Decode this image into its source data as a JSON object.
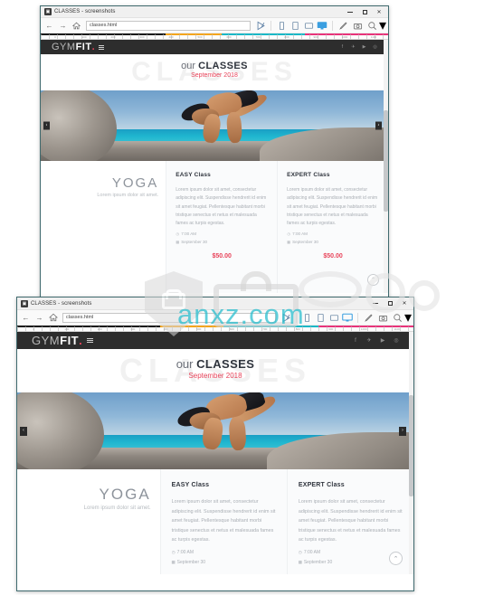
{
  "windows": {
    "top": {
      "title": "CLASSES - screenshots",
      "url": "classes.html"
    },
    "bottom": {
      "title": "CLASSES - screenshots",
      "url": "classes.html"
    }
  },
  "toolbar": {
    "back_icon": "←",
    "forward_icon": "→",
    "home_icon": "⌂",
    "play_icon": "▷",
    "phone_icon": "phone",
    "tablet_portrait_icon": "tablet-portrait",
    "tablet_landscape_icon": "tablet-landscape",
    "desktop_icon": "desktop",
    "pen_icon": "pen",
    "camera_icon": "camera",
    "inspect_icon": "inspect",
    "dropdown_caret": "▾"
  },
  "window_controls": {
    "minimize": "—",
    "maximize": "☐",
    "close": "✕"
  },
  "ruler": {
    "labels": [
      "0",
      "100",
      "200",
      "300",
      "400",
      "500",
      "600",
      "700",
      "800",
      "900",
      "1000",
      "1100"
    ],
    "segments": [
      {
        "color": "#1b1b1b",
        "left": "0%",
        "width": "36%"
      },
      {
        "color": "#f4a51c",
        "left": "36%",
        "width": "16%"
      },
      {
        "color": "#19b8c6",
        "left": "52%",
        "width": "24%"
      },
      {
        "color": "#e8337a",
        "left": "76%",
        "width": "24%"
      }
    ]
  },
  "site": {
    "logo": {
      "gym": "GYM",
      "fit": "FIT",
      "dot": "."
    },
    "menu_icon": "hamburger-icon",
    "socials": [
      {
        "name": "facebook-icon",
        "glyph": "f"
      },
      {
        "name": "twitter-icon",
        "glyph": "✈"
      },
      {
        "name": "youtube-icon",
        "glyph": "▶"
      },
      {
        "name": "instagram-icon",
        "glyph": "◎"
      }
    ],
    "hero": {
      "watermark": "CLASSES",
      "pre_title": "our",
      "title": "CLASSES",
      "subtitle": "September 2018",
      "prev_icon": "‹",
      "next_icon": "›",
      "image_alt": "woman doing a yoga crow pose on a rock by the sea"
    },
    "intro": {
      "title": "YOGA",
      "lead": "Lorem ipsum dolor sit amet."
    },
    "cards": [
      {
        "title": "EASY Class",
        "body": "Lorem ipsum dolor sit amet, consectetur adipiscing elit. Suspendisse hendrerit id enim sit amet feugiat. Pellentesque habitant morbi tristique senectus et netus et malesuada fames ac turpis egestas.",
        "time": "7:00 AM",
        "date": "September 30",
        "price": "$50.00",
        "time_icon": "clock-icon",
        "date_icon": "calendar-icon"
      },
      {
        "title": "EXPERT Class",
        "body": "Lorem ipsum dolor sit amet, consectetur adipiscing elit. Suspendisse hendrerit id enim sit amet feugiat. Pellentesque habitant morbi tristique senectus et netus et malesuada fames ac turpis egestas.",
        "time": "7:00 AM",
        "date": "September 30",
        "price": "$50.00",
        "time_icon": "clock-icon",
        "date_icon": "calendar-icon"
      }
    ],
    "back_to_top_icon": "⌃"
  },
  "overlay_watermark": {
    "text": "anxz.com"
  },
  "colors": {
    "accent_red": "#e8435a",
    "header_dark": "#2d2d2d",
    "window_border": "#3f6a6e",
    "watermark_teal": "#2bbfcf"
  }
}
